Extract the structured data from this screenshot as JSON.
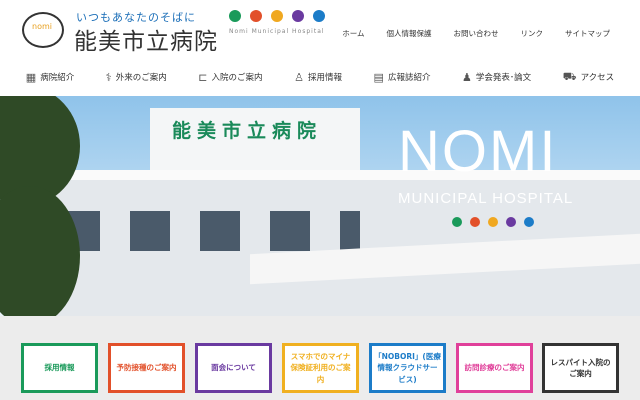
{
  "header": {
    "tagline": "いつもあなたのそばに",
    "title": "能美市立病院",
    "subtitle": "Nomi Municipal Hospital",
    "logo_text": "nomi",
    "dots": [
      "#1a9a5a",
      "#e2502a",
      "#f0a820",
      "#6a3aa0",
      "#1c7cc8"
    ],
    "util_links": [
      "ホーム",
      "個人情報保護",
      "お問い合わせ",
      "リンク",
      "サイトマップ"
    ]
  },
  "nav": [
    {
      "label": "病院紹介",
      "icon": "building-icon"
    },
    {
      "label": "外来のご案内",
      "icon": "stethoscope-icon"
    },
    {
      "label": "入院のご案内",
      "icon": "bed-icon"
    },
    {
      "label": "採用情報",
      "icon": "person-icon"
    },
    {
      "label": "広報誌紹介",
      "icon": "book-icon"
    },
    {
      "label": "学会発表･論文",
      "icon": "presenter-icon"
    },
    {
      "label": "アクセス",
      "icon": "car-icon"
    }
  ],
  "hero": {
    "sign": "能美市立病院",
    "title": "NOMI",
    "subtitle": "MUNICIPAL HOSPITAL"
  },
  "links": [
    {
      "label": "採用情報",
      "color": "#1a9a5a"
    },
    {
      "label": "予防接種のご案内",
      "color": "#e2502a"
    },
    {
      "label": "面会について",
      "color": "#6a3aa0"
    },
    {
      "label": "スマホでのマイナ保険証利用のご案内",
      "color": "#f0b020"
    },
    {
      "label": "「NOBORI」(医療情報クラウドサービス)",
      "color": "#1c7cc8"
    },
    {
      "label": "訪問診療のご案内",
      "color": "#e0409a"
    },
    {
      "label": "レスパイト入院のご案内",
      "color": "#333333"
    }
  ]
}
